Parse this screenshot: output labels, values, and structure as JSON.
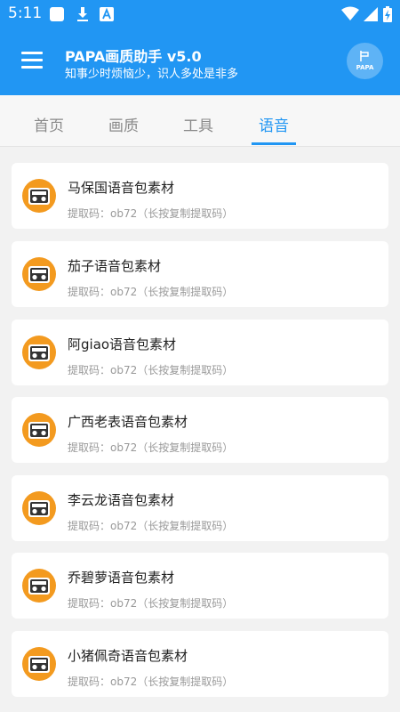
{
  "status_bar": {
    "time": "5:11",
    "left_icons": [
      "app-square-icon",
      "download-icon",
      "font-a-icon"
    ],
    "right_icons": [
      "wifi-icon",
      "signal-icon",
      "battery-charging-icon"
    ]
  },
  "app_bar": {
    "title": "PAPA画质助手 v5.0",
    "subtitle": "知事少时烦恼少，识人多处是非多",
    "logo_text": "PAPA"
  },
  "tabs": [
    {
      "label": "首页",
      "active": false
    },
    {
      "label": "画质",
      "active": false
    },
    {
      "label": "工具",
      "active": false
    },
    {
      "label": "语音",
      "active": true
    }
  ],
  "items": [
    {
      "title": "马保国语音包素材",
      "subtitle": "提取码：ob72（长按复制提取码）"
    },
    {
      "title": "茄子语音包素材",
      "subtitle": "提取码：ob72（长按复制提取码）"
    },
    {
      "title": "阿giao语音包素材",
      "subtitle": "提取码：ob72（长按复制提取码）"
    },
    {
      "title": "广西老表语音包素材",
      "subtitle": "提取码：ob72（长按复制提取码）"
    },
    {
      "title": "李云龙语音包素材",
      "subtitle": "提取码：ob72（长按复制提取码）"
    },
    {
      "title": "乔碧萝语音包素材",
      "subtitle": "提取码：ob72（长按复制提取码）"
    },
    {
      "title": "小猪佩奇语音包素材",
      "subtitle": "提取码：ob72（长按复制提取码）"
    }
  ],
  "colors": {
    "primary": "#2196f3",
    "icon_orange": "#f39a1f",
    "card_bg": "#ffffff",
    "page_bg": "#f2f2f2"
  }
}
